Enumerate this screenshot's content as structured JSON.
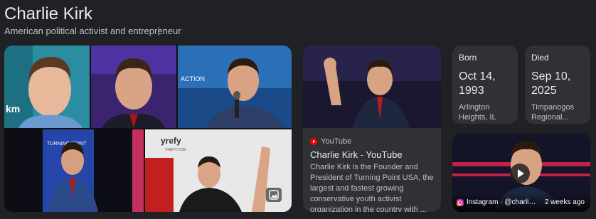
{
  "header": {
    "title": "Charlie Kirk",
    "subtitle": "American political activist and entrepreneur",
    "more_icon": "more-vert-icon"
  },
  "image_grid": {
    "photo_count": 5,
    "gallery_icon": "image-icon",
    "watermark_text": "km",
    "banner_text": "ACTION",
    "sign_text": "yrefy",
    "sign_subtext": "YREFY.COM",
    "tp_text": "TURNING POINT"
  },
  "video_card": {
    "source": "YouTube",
    "title": "Charlie Kirk - YouTube",
    "description": "Charlie Kirk is the Founder and President of Turning Point USA, the largest and fastest growing conservative youth activist organization in the country with ..."
  },
  "facts": {
    "born": {
      "label": "Born",
      "date": "Oct 14, 1993",
      "place": "Arlington Heights, IL"
    },
    "died": {
      "label": "Died",
      "date": "Sep 10, 2025",
      "place": "Timpanogos Regional..."
    }
  },
  "social_video": {
    "source": "Instagram · @charlieki...",
    "time": "2 weeks ago",
    "icon": "play-icon"
  },
  "colors": {
    "background": "#202124",
    "card": "#303134",
    "text_primary": "#e8eaed",
    "text_secondary": "#bdc1c6",
    "youtube_red": "#ff0000"
  }
}
